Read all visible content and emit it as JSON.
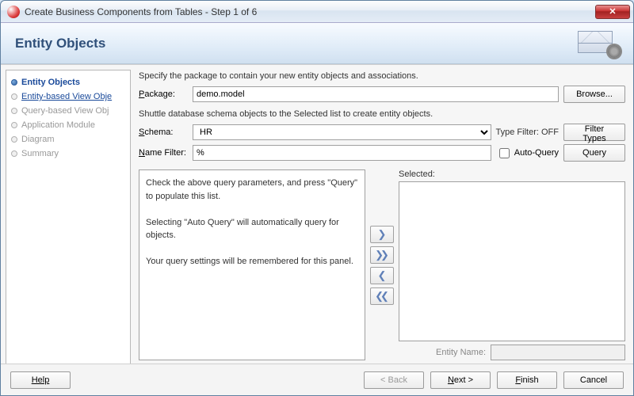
{
  "window": {
    "title": "Create Business Components from Tables - Step 1 of 6"
  },
  "header": {
    "title": "Entity Objects"
  },
  "steps": {
    "s0": "Entity Objects",
    "s1": "Entity-based View Obje",
    "s2": "Query-based View Obj",
    "s3": "Application Module",
    "s4": "Diagram",
    "s5": "Summary"
  },
  "main": {
    "desc1": "Specify the package to contain your new entity objects and associations.",
    "package_label": "Package:",
    "package_value": "demo.model",
    "browse_label": "Browse...",
    "desc2": "Shuttle database schema objects to the Selected list to create entity objects.",
    "schema_label": "Schema:",
    "schema_value": "HR",
    "type_filter_label": "Type Filter: OFF",
    "filter_types_label": "Filter Types",
    "name_filter_label": "Name Filter:",
    "name_filter_value": "%",
    "auto_query_label": "Auto-Query",
    "query_label": "Query",
    "available_hint_1": "Check the above query parameters, and press \"Query\" to populate this list.",
    "available_hint_2": "Selecting \"Auto Query\" will automatically query for objects.",
    "available_hint_3": "Your query settings will be remembered for this panel.",
    "selected_label": "Selected:",
    "entity_name_label": "Entity Name:",
    "entity_name_value": ""
  },
  "footer": {
    "help": "Help",
    "back": "< Back",
    "next": "Next >",
    "finish": "Finish",
    "cancel": "Cancel"
  }
}
